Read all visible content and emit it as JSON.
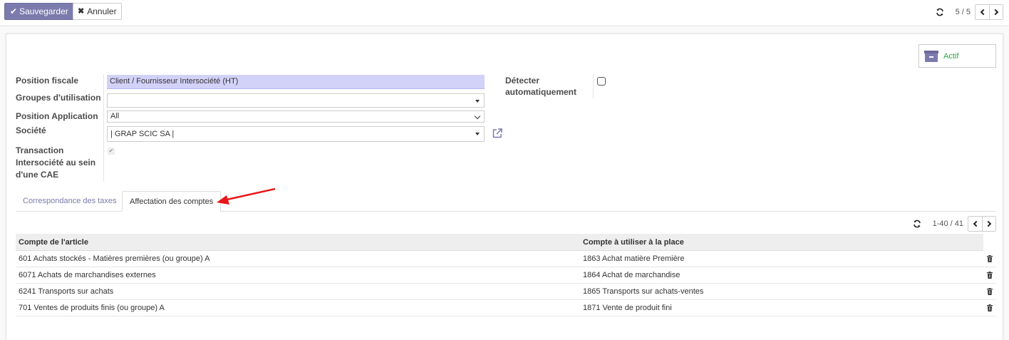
{
  "toolbar": {
    "save_label": "Sauvegarder",
    "cancel_label": "Annuler",
    "record_pager": "5 / 5"
  },
  "status": {
    "active_label": "Actif"
  },
  "form": {
    "position_fiscale_label": "Position fiscale",
    "position_fiscale_value": "Client / Fournisseur Intersociété (HT)",
    "groupes_label": "Groupes d'utilisation",
    "groupes_value": "",
    "application_label": "Position Application",
    "application_value": "All",
    "societe_label": "Société",
    "societe_value": "| GRAP SCIC SA |",
    "transaction_label_1": "Transaction",
    "transaction_label_2": "Intersociété au sein",
    "transaction_label_3": "d'une CAE",
    "detect_label_1": "Détecter",
    "detect_label_2": "automatiquement"
  },
  "tabs": [
    {
      "label": "Correspondance des taxes"
    },
    {
      "label": "Affectation des comptes"
    }
  ],
  "list": {
    "pager": "1-40 / 41",
    "columns": [
      "Compte de l'article",
      "Compte à utiliser à la place"
    ],
    "rows": [
      {
        "src": "601 Achats stockés - Matières premières (ou groupe) A",
        "dest": "1863 Achat matière Première"
      },
      {
        "src": "6071 Achats de marchandises externes",
        "dest": "1864 Achat de marchandise"
      },
      {
        "src": "6241 Transports sur achats",
        "dest": "1865 Transports sur achats-ventes"
      },
      {
        "src": "701 Ventes de produits finis (ou groupe) A",
        "dest": "1871 Vente de produit fini"
      }
    ]
  },
  "colors": {
    "primary": "#7c7bad",
    "highlight_field": "#d2d2f9",
    "active_green": "#28a745",
    "annotation_arrow": "#e8161b"
  }
}
